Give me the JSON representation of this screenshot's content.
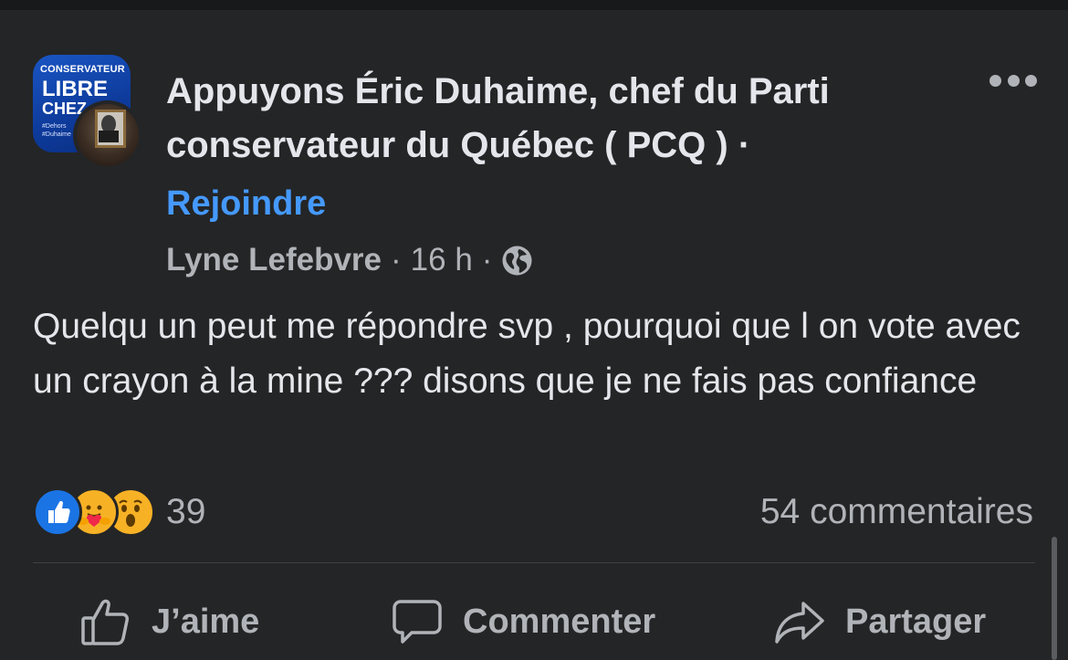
{
  "group": {
    "name": "Appuyons Éric Duhaime, chef du Parti conservateur du Québec ( PCQ ) ·",
    "join_label": "Rejoindre",
    "avatar_logo_top": "CONSERVATEUR",
    "avatar_logo_big": "LIBRE",
    "avatar_logo_mid": "CHEZ",
    "avatar_logo_tags": "#Dehors\n#Duhaime"
  },
  "meta": {
    "author": "Lyne Lefebvre",
    "separator": "·",
    "time": "16 h",
    "audience_icon": "globe-icon"
  },
  "post": {
    "text": "Quelqu un peut me répondre svp , pourquoi que l on vote avec un crayon à la mine ??? disons que je ne fais pas confiance"
  },
  "reactions": {
    "types": [
      "like",
      "care",
      "wow"
    ],
    "count": "39",
    "comments": "54 commentaires"
  },
  "actions": {
    "like_label": "J’aime",
    "comment_label": "Commenter",
    "share_label": "Partager"
  },
  "colors": {
    "background": "#242526",
    "text_primary": "#e4e6eb",
    "text_secondary": "#b0b3b8",
    "link_blue": "#4599ff",
    "like_blue": "#1b74e4",
    "reaction_yellow": "#f7b125"
  }
}
